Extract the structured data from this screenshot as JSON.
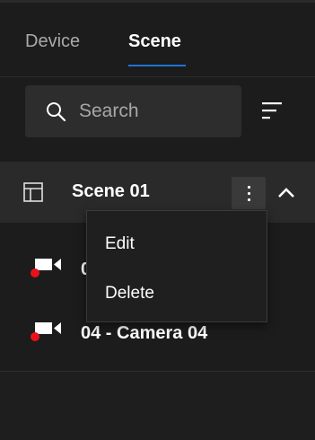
{
  "tabs": [
    {
      "label": "Device",
      "active": false
    },
    {
      "label": "Scene",
      "active": true
    }
  ],
  "search": {
    "placeholder": "Search",
    "value": "",
    "icon": "search-icon"
  },
  "sort": {
    "icon": "sort-icon"
  },
  "scene": {
    "title": "Scene 01",
    "icon": "layout-icon",
    "expanded": true,
    "cameras": [
      {
        "label": "0",
        "icon": "camera-icon",
        "status": "offline"
      },
      {
        "label": "04 - Camera 04",
        "icon": "camera-icon",
        "status": "offline"
      }
    ]
  },
  "context_menu": {
    "items": [
      {
        "label": "Edit"
      },
      {
        "label": "Delete"
      }
    ]
  },
  "colors": {
    "background": "#1c1c1c",
    "accent": "#1e73d6",
    "status_offline": "#e8121c"
  }
}
